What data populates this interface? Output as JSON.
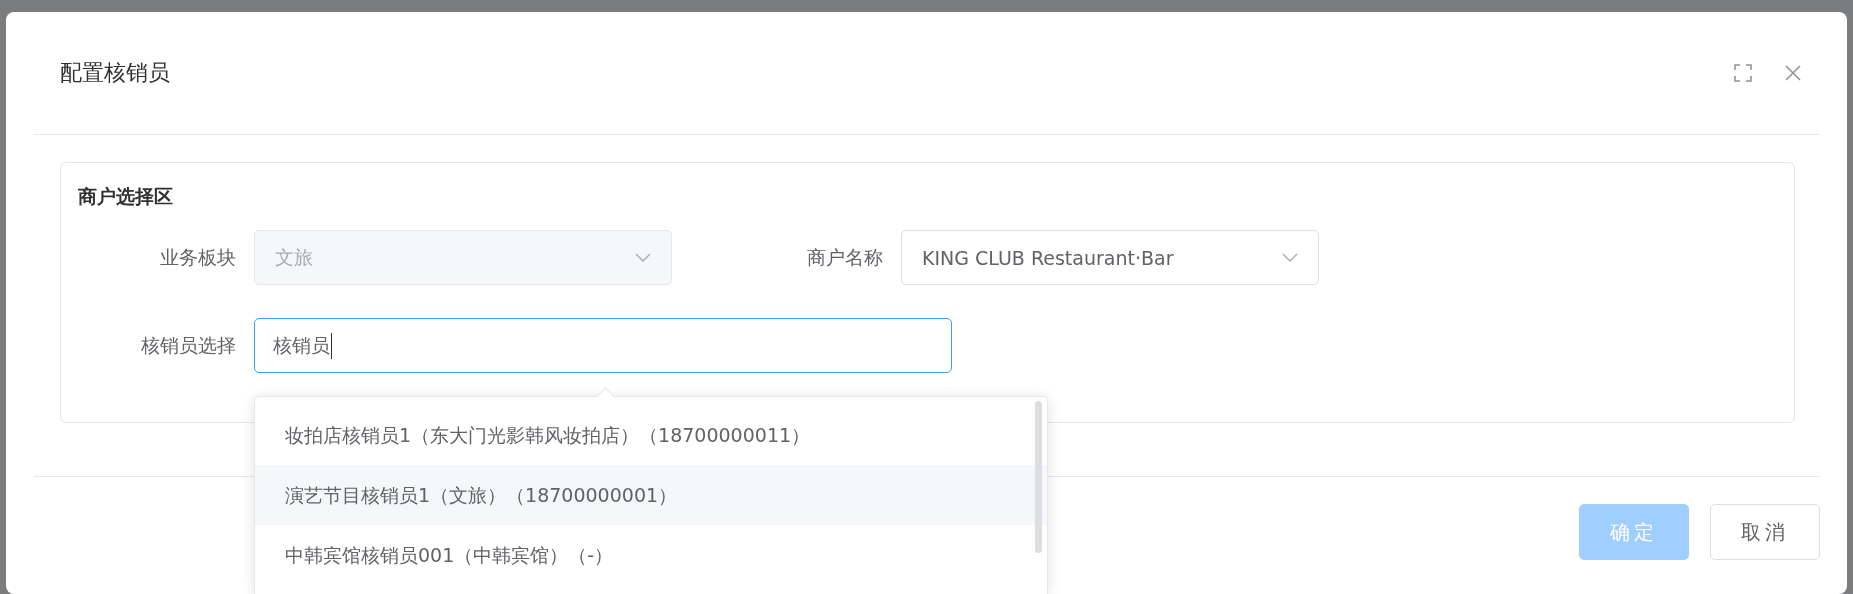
{
  "dialog": {
    "title": "配置核销员",
    "section": {
      "title": "商户选择区",
      "rows": [
        {
          "fields": [
            {
              "kind": "select",
              "label": "业务板块",
              "value": "文旅",
              "disabled": true
            },
            {
              "kind": "select",
              "label": "商户名称",
              "value": "KING CLUB Restaurant·Bar",
              "disabled": false
            }
          ]
        },
        {
          "fields": [
            {
              "kind": "input",
              "label": "核销员选择",
              "value": "核销员",
              "focused": true
            }
          ]
        }
      ]
    },
    "dropdown": {
      "options": [
        {
          "label": "妆拍店核销员1（东大门光影韩风妆拍店）（18700000011）",
          "selected": false
        },
        {
          "label": "演艺节目核销员1（文旅）（18700000001）",
          "selected": true
        },
        {
          "label": "中韩宾馆核销员001（中韩宾馆）（-）",
          "selected": false
        }
      ]
    },
    "buttons": [
      {
        "label": "确定",
        "kind": "primary",
        "disabled": true
      },
      {
        "label": "取消",
        "kind": "default",
        "disabled": false
      }
    ]
  }
}
